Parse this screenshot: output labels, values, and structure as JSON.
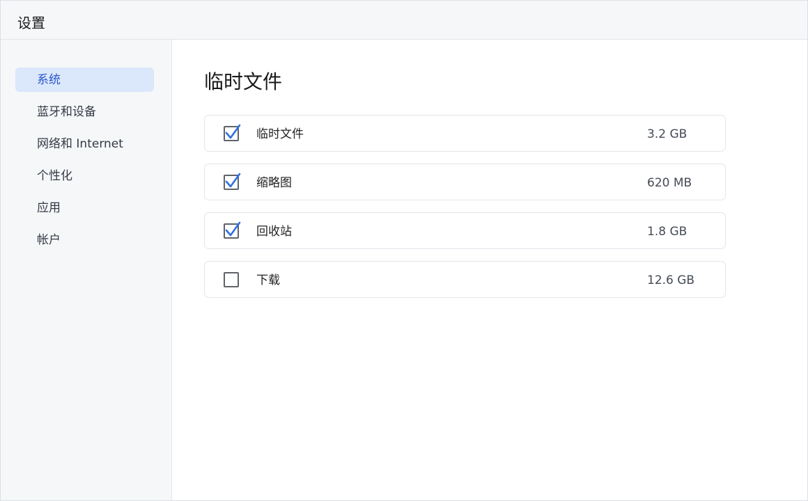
{
  "window": {
    "title": "设置"
  },
  "sidebar": {
    "items": [
      {
        "label": "系统",
        "active": true
      },
      {
        "label": "蓝牙和设备",
        "active": false
      },
      {
        "label": "网络和 Internet",
        "active": false
      },
      {
        "label": "个性化",
        "active": false
      },
      {
        "label": "应用",
        "active": false
      },
      {
        "label": "帐户",
        "active": false
      }
    ]
  },
  "main": {
    "title": "临时文件",
    "items": [
      {
        "label": "临时文件",
        "size": "3.2 GB",
        "checked": true
      },
      {
        "label": "缩略图",
        "size": "620 MB",
        "checked": true
      },
      {
        "label": "回收站",
        "size": "1.8 GB",
        "checked": true
      },
      {
        "label": "下载",
        "size": "12.6 GB",
        "checked": false
      }
    ]
  },
  "colors": {
    "accent": "#2a57c9",
    "check": "#2f6fe0",
    "active_nav_bg": "#dbe7fb"
  },
  "icons": {
    "check": "checkmark-icon"
  }
}
